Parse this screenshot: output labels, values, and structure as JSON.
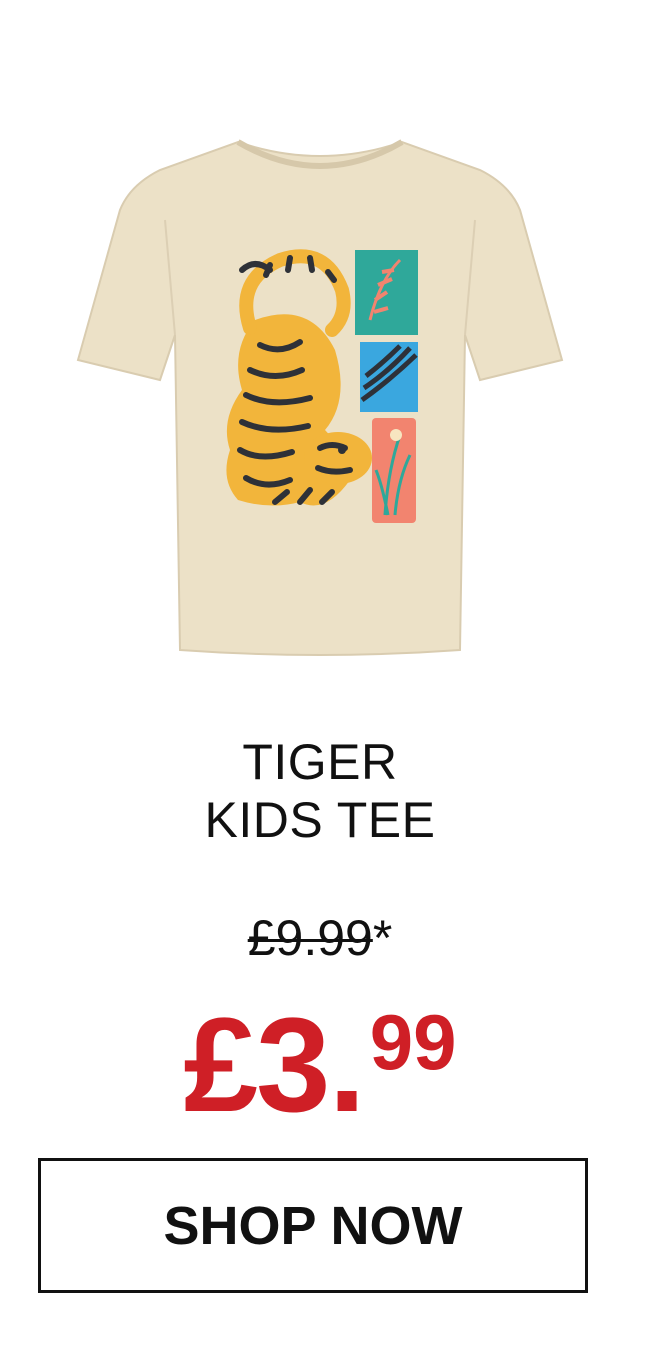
{
  "product": {
    "title_line1": "TIGER",
    "title_line2": "KIDS TEE",
    "old_price": "£9.99",
    "old_price_suffix": "*",
    "new_price_main": "£3.",
    "new_price_cents": "99",
    "image_icon": "tiger-tshirt-image"
  },
  "cta": {
    "label": "SHOP NOW"
  },
  "colors": {
    "shirt": "#ece1c7",
    "price_red": "#cf1f26",
    "tiger_yellow": "#f2b53b",
    "stripe_dark": "#2e3138",
    "panel_teal": "#2fa89a",
    "panel_blue": "#3aa7df",
    "panel_coral": "#f2846f"
  }
}
